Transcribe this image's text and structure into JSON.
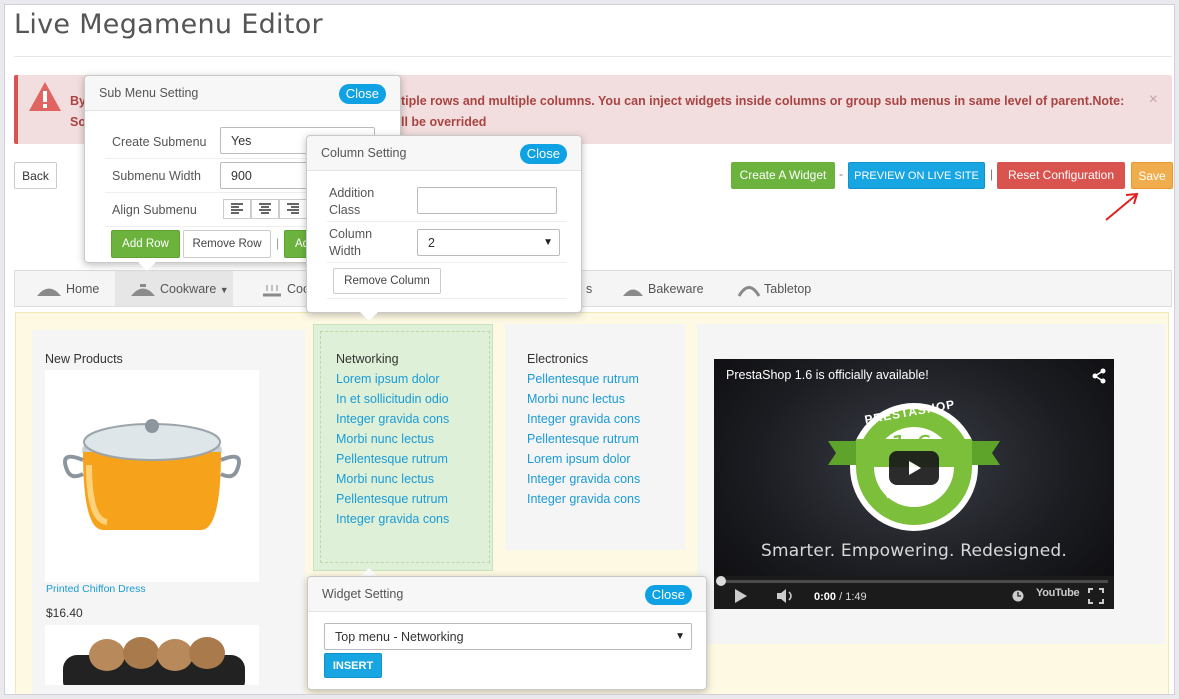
{
  "app": {
    "title": "Live Megamenu Editor"
  },
  "alert": {
    "text_left": "By",
    "text_left2": "Sor",
    "text_right": "tiple rows and multiple columns. You can inject widgets inside columns or group sub menus in same level of parent.Note:",
    "text_right2": "ll be overrided",
    "close": "×"
  },
  "toolbar": {
    "back": "Back",
    "create_widget": "Create A Widget",
    "sep1": "-",
    "preview": "PREVIEW ON LIVE SITE",
    "sep2": "|",
    "reset": "Reset Configuration",
    "save": "Save"
  },
  "menu": {
    "items": [
      {
        "label": "Home"
      },
      {
        "label": "Cookware"
      },
      {
        "label": "Coo"
      },
      {
        "label": "s"
      },
      {
        "label": "Bakeware"
      },
      {
        "label": "Tabletop"
      }
    ]
  },
  "columns": {
    "products": {
      "heading": "New Products",
      "item_name": "Printed Chiffon Dress",
      "item_price": "$16.40"
    },
    "networking": {
      "heading": "Networking",
      "links": [
        "Lorem ipsum dolor",
        "In et sollicitudin odio",
        "Integer gravida cons",
        "Morbi nunc lectus",
        "Pellentesque rutrum",
        "Morbi nunc lectus",
        "Pellentesque rutrum",
        "Integer gravida cons"
      ]
    },
    "electronics": {
      "heading": "Electronics",
      "links": [
        "Pellentesque rutrum",
        "Morbi nunc lectus",
        "Integer gravida cons",
        "Pellentesque rutrum",
        "Lorem ipsum dolor",
        "Integer gravida cons",
        "Integer gravida cons"
      ]
    }
  },
  "video": {
    "title": "PrestaShop 1.6 is officially available!",
    "tagline": "Smarter. Empowering. Redesigned.",
    "current": "0:00",
    "duration": "/ 1:49",
    "badge_top": "PRESTASHOP",
    "badge_version": "1.6",
    "badge_bottom": "VERSION",
    "brand": "YouTube"
  },
  "submenu_popover": {
    "title": "Sub Menu Setting",
    "close": "Close",
    "create_label": "Create Submenu",
    "create_value": "Yes",
    "width_label": "Submenu Width",
    "width_value": "900",
    "align_label": "Align Submenu",
    "add_row": "Add Row",
    "remove_row": "Remove Row",
    "add_col_partial": "Ad",
    "sep": "|"
  },
  "column_popover": {
    "title": "Column Setting",
    "close": "Close",
    "class_label_1": "Addition",
    "class_label_2": "Class",
    "class_value": "",
    "width_label_1": "Column",
    "width_label_2": "Width",
    "width_value": "2",
    "remove": "Remove Column"
  },
  "widget_popover": {
    "title": "Widget Setting",
    "close": "Close",
    "select_value": "Top menu - Networking",
    "insert": "INSERT"
  },
  "colors": {
    "green": "#6cb33e",
    "blue": "#18a6e2",
    "red": "#d9534f",
    "orange": "#f0ad4e",
    "link": "#1a9bd7"
  }
}
